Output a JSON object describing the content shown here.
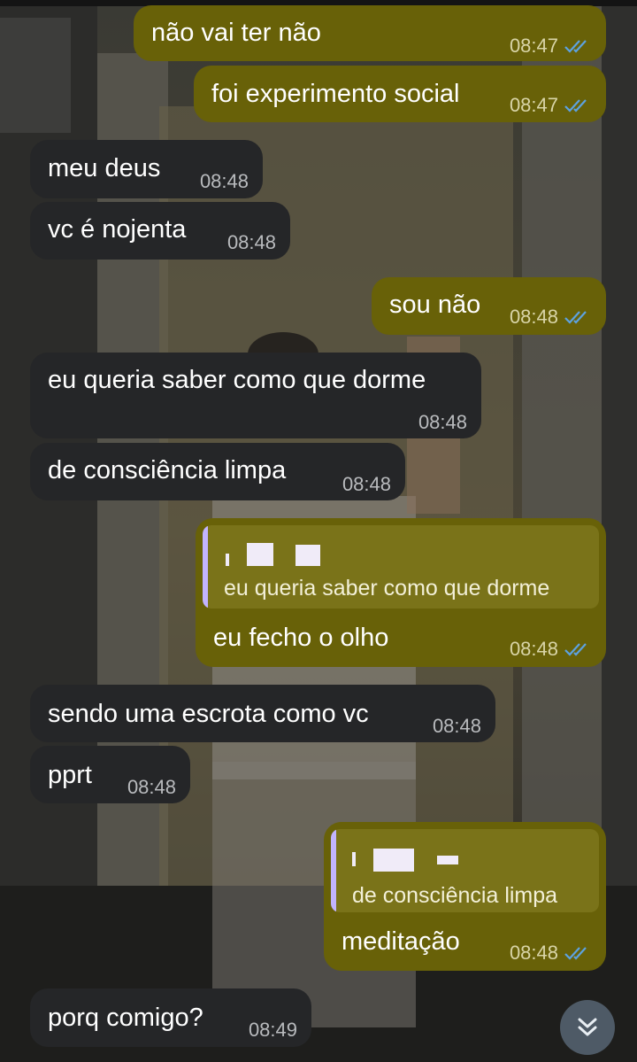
{
  "colors": {
    "outgoing_bubble": "#686108",
    "incoming_bubble": "#252628",
    "read_ticks": "#5da2e0",
    "reply_bar": "#c2b4ff"
  },
  "messages": [
    {
      "id": "m1",
      "direction": "outgoing",
      "text": "não vai ter não",
      "time": "08:47",
      "status": "read"
    },
    {
      "id": "m2",
      "direction": "outgoing",
      "text": "foi experimento social",
      "time": "08:47",
      "status": "read"
    },
    {
      "id": "m3",
      "direction": "incoming",
      "text": "meu deus",
      "time": "08:48"
    },
    {
      "id": "m4",
      "direction": "incoming",
      "text": "vc é nojenta",
      "time": "08:48"
    },
    {
      "id": "m5",
      "direction": "outgoing",
      "text": "sou não",
      "time": "08:48",
      "status": "read"
    },
    {
      "id": "m6",
      "direction": "incoming",
      "text": "eu queria saber como que dorme",
      "time": "08:48"
    },
    {
      "id": "m7",
      "direction": "incoming",
      "text": "de consciência limpa",
      "time": "08:48"
    },
    {
      "id": "m8",
      "direction": "outgoing",
      "text": "eu fecho o olho",
      "time": "08:48",
      "status": "read",
      "reply_to": {
        "text": "eu queria saber como que dorme"
      }
    },
    {
      "id": "m9",
      "direction": "incoming",
      "text": "sendo uma escrota como vc",
      "time": "08:48"
    },
    {
      "id": "m10",
      "direction": "incoming",
      "text": "pprt",
      "time": "08:48"
    },
    {
      "id": "m11",
      "direction": "outgoing",
      "text": "meditação",
      "time": "08:48",
      "status": "read",
      "reply_to": {
        "text": "de consciência limpa"
      }
    },
    {
      "id": "m12",
      "direction": "incoming",
      "text": "porq comigo?",
      "time": "08:49"
    }
  ],
  "scroll_button": {
    "icon": "double-chevron-down-icon"
  }
}
